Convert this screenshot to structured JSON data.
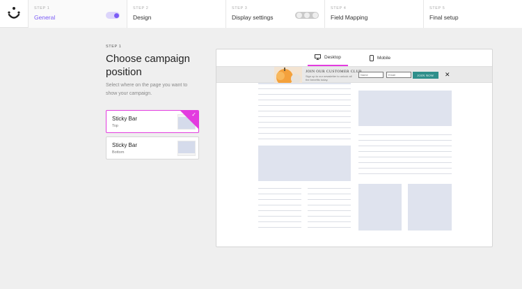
{
  "steps": [
    {
      "num": "STEP 1",
      "label": "General"
    },
    {
      "num": "STEP 2",
      "label": "Design"
    },
    {
      "num": "STEP 3",
      "label": "Display settings"
    },
    {
      "num": "STEP 4",
      "label": "Field Mapping"
    },
    {
      "num": "STEP 5",
      "label": "Final setup"
    }
  ],
  "left": {
    "kicker": "STEP 1",
    "title": "Choose campaign position",
    "description": "Select where on the page you want to show your campaign.",
    "options": [
      {
        "title": "Sticky Bar",
        "subtitle": "Top",
        "selected": true
      },
      {
        "title": "Sticky Bar",
        "subtitle": "Bottom",
        "selected": false
      }
    ]
  },
  "preview": {
    "tabs": [
      {
        "label": "Desktop",
        "icon": "desktop-icon",
        "active": true
      },
      {
        "label": "Mobile",
        "icon": "mobile-icon",
        "active": false
      }
    ],
    "bar": {
      "title": "JOIN OUR CUSTOMER CLUB",
      "text": "Sign up to our newsletter to unlock all the benefits today.",
      "name_placeholder": "Name",
      "email_placeholder": "Email",
      "button": "JOIN NOW",
      "close": "✕"
    }
  },
  "colors": {
    "accent": "#7b5cf5",
    "selection": "#e33bdf",
    "button": "#2f8f8b"
  }
}
